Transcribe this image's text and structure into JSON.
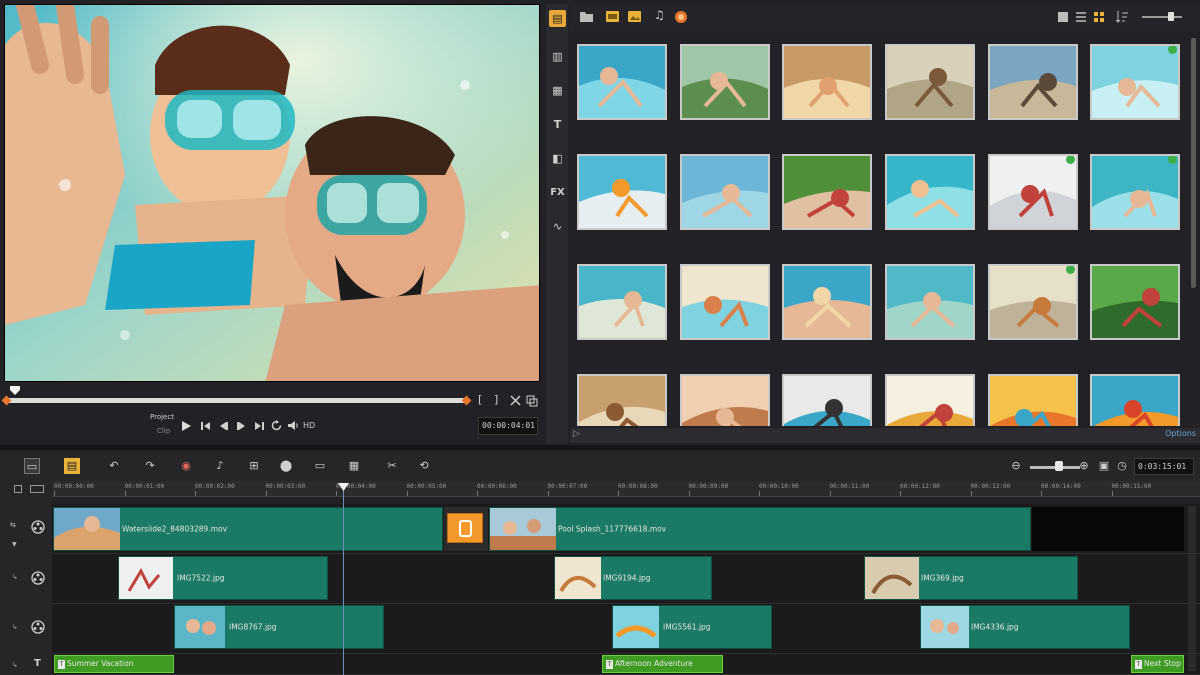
{
  "preview": {
    "mode_project": "Project",
    "mode_clip": "Clip",
    "hd_label": "HD",
    "timecode": "00:00:04:01"
  },
  "library": {
    "options_label": "Options"
  },
  "timeline": {
    "timecode": "0:03:15:01",
    "ruler": [
      "00:00:00:00",
      "00:00:01:00",
      "00:00:02:00",
      "00:00:03:00",
      "00:00:04:00",
      "00:00:05:00",
      "00:00:06:00",
      "00:00:07:00",
      "00:00:08:00",
      "00:00:09:00",
      "00:00:10:00",
      "00:00:11:00",
      "00:00:12:00",
      "00:00:13:00",
      "00:00:14:00",
      "00:00:15:00"
    ],
    "video_clips": [
      "Waterslide2_84803289.mov",
      "Pool Splash_117776618.mov"
    ],
    "overlay1_clips": [
      "IMG7522.jpg",
      "IMG9194.jpg",
      "IMG369.jpg"
    ],
    "overlay2_clips": [
      "IMG8767.jpg",
      "IMG5561.jpg",
      "IMG4336.jpg"
    ],
    "title_clips": [
      "Summer Vacation",
      "Afternoon Adventure",
      "Next Stop"
    ]
  },
  "colors": {
    "clip_teal": "#1b7a66",
    "title_green": "#3f9b22",
    "accent_orange": "#e8762b",
    "transition_orange": "#f39a2b"
  },
  "icons": [
    "folder-icon",
    "video-folder-icon",
    "photo-folder-icon",
    "music-icon",
    "instant-project-icon",
    "title-icon",
    "graphics-icon",
    "fx-icon",
    "transition-icon",
    "path-icon",
    "undo-icon",
    "redo-icon",
    "record-icon",
    "audio-icon",
    "motion-icon",
    "mask-icon",
    "subtitle-icon",
    "multicam-icon",
    "zoom-in-icon",
    "zoom-out-icon",
    "fit-icon",
    "clock-icon"
  ]
}
